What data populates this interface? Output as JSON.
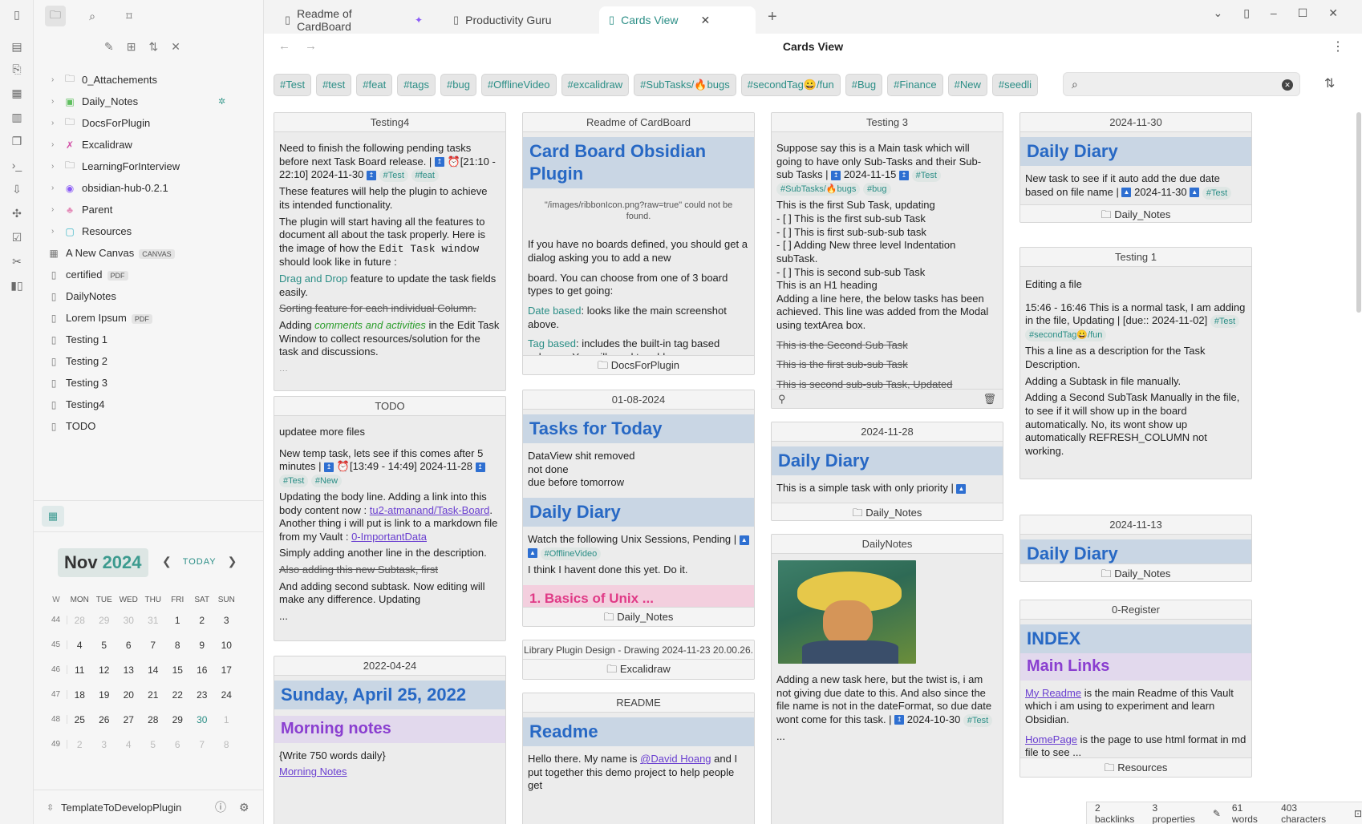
{
  "sidebar": {
    "tree": [
      {
        "type": "folder",
        "label": "0_Attachements",
        "icon": "folder-icon"
      },
      {
        "type": "folder",
        "label": "Daily_Notes",
        "icon": "calendar-folder-icon"
      },
      {
        "type": "folder",
        "label": "DocsForPlugin",
        "icon": "folder-icon"
      },
      {
        "type": "folder",
        "label": "Excalidraw",
        "icon": "excalidraw-icon"
      },
      {
        "type": "folder",
        "label": "LearningForInterview",
        "icon": "folder-icon"
      },
      {
        "type": "folder",
        "label": "obsidian-hub-0.2.1",
        "icon": "obsidian-hub-icon"
      },
      {
        "type": "folder",
        "label": "Parent",
        "icon": "tree-icon"
      },
      {
        "type": "folder",
        "label": "Resources",
        "icon": "resources-icon"
      }
    ],
    "files": [
      {
        "label": "A New Canvas",
        "badge": "CANVAS"
      },
      {
        "label": "certified",
        "badge": "PDF"
      },
      {
        "label": "DailyNotes",
        "badge": ""
      },
      {
        "label": "Lorem Ipsum",
        "badge": "PDF"
      },
      {
        "label": "Testing 1",
        "badge": ""
      },
      {
        "label": "Testing 2",
        "badge": ""
      },
      {
        "label": "Testing 3",
        "badge": ""
      },
      {
        "label": "Testing4",
        "badge": ""
      },
      {
        "label": "TODO",
        "badge": ""
      }
    ],
    "vault_name": "TemplateToDevelopPlugin"
  },
  "calendar": {
    "month": "Nov",
    "year": "2024",
    "today_label": "TODAY",
    "dow": [
      "W",
      "MON",
      "TUE",
      "WED",
      "THU",
      "FRI",
      "SAT",
      "SUN"
    ],
    "weeks": [
      {
        "wk": "44",
        "days": [
          "28",
          "29",
          "30",
          "31",
          "1",
          "2",
          "3"
        ]
      },
      {
        "wk": "45",
        "days": [
          "4",
          "5",
          "6",
          "7",
          "8",
          "9",
          "10"
        ]
      },
      {
        "wk": "46",
        "days": [
          "11",
          "12",
          "13",
          "14",
          "15",
          "16",
          "17"
        ]
      },
      {
        "wk": "47",
        "days": [
          "18",
          "19",
          "20",
          "21",
          "22",
          "23",
          "24"
        ]
      },
      {
        "wk": "48",
        "days": [
          "25",
          "26",
          "27",
          "28",
          "29",
          "30",
          "1"
        ]
      },
      {
        "wk": "49",
        "days": [
          "2",
          "3",
          "4",
          "5",
          "6",
          "7",
          "8"
        ]
      }
    ]
  },
  "tabs": [
    {
      "label": "Readme of CardBoard"
    },
    {
      "label": "Productivity Guru"
    },
    {
      "label": "Cards View"
    }
  ],
  "view_title": "Cards View",
  "tag_filters": [
    "#Test",
    "#test",
    "#feat",
    "#tags",
    "#bug",
    "#OfflineVideo",
    "#excalidraw",
    "#SubTasks/🔥bugs",
    "#secondTag😀/fun",
    "#Bug",
    "#Finance",
    "#New",
    "#seedli"
  ],
  "cards": {
    "testing4": {
      "title": "Testing4",
      "p1": "Need to finish the following pending tasks before next Task Board release. |",
      "p1b": "⏰[21:10 - 22:10]",
      "p1c": "2024-11-30",
      "tag1": "#Test",
      "tag2": "#feat",
      "p2": "These features will help the plugin to achieve its intended functionality.",
      "p3a": "The plugin will start having all the features to document all about the task properly. Here is the image of how the ",
      "p3code": "Edit Task window",
      "p3b": " should look like in future :",
      "p4link": "Drag and Drop",
      "p4": " feature to update the task fields easily.",
      "p5": "Sorting feature for each individual Column.",
      "p6a": "Adding ",
      "p6green": "comments and activities",
      "p6b": " in the Edit Task Window to collect resources/solution for the task and discussions.",
      "ellipsis": "..."
    },
    "todo": {
      "title": "TODO",
      "p1": "updatee more files",
      "p2": "New temp task, lets see if this comes after 5 minutes |",
      "p2b": "⏰[13:49 - 14:49]",
      "p2c": "2024-11-28",
      "tag1": "#Test",
      "tag2": "#New",
      "p3a": "Updating the body line. Adding a link into this body content now : ",
      "p3link": "tu2-atmanand/Task-Board",
      "p3b": ". Another thing i will put is link to a markdown file from my Vault : ",
      "p3link2": "0-ImportantData",
      "p4": "Simply adding another line in the description.",
      "p5": "Also adding this new Subtask, first",
      "p6": "And adding second subtask. Now editing will make any difference. Updating",
      "ellipsis": "..."
    },
    "sunday": {
      "title": "2022-04-24",
      "h1": "Sunday, April 25, 2022",
      "h2": "Morning notes",
      "p1": "{Write 750 words daily}",
      "p2": "Morning Notes"
    },
    "readme": {
      "title": "Readme of CardBoard",
      "h1": "Card Board Obsidian Plugin",
      "img": "\"/images/ribbonIcon.png?raw=true\" could not be found.",
      "p1": "If you have no boards defined, you should get a dialog asking you to add a new",
      "p2": "board.  You can choose from one of 3 board types to get going:",
      "p3link": "Date based",
      "p3": ": looks like the main screenshot above.",
      "p4link": "Tag based",
      "p4": ": includes the built-in tag based columns.  You will need to add",
      "ellipsis": "...",
      "footer": "DocsForPlugin"
    },
    "tasks_today": {
      "title": "01-08-2024",
      "h1": "Tasks for Today",
      "p1": "DataView shit removed",
      "p2": "not done",
      "p3": "due before tomorrow",
      "h1b": "Daily Diary",
      "p4": "Watch the following Unix Sessions, Pending |",
      "tag1": "#OfflineVideo",
      "p5": "I think I havent done this yet. Do it.",
      "h2": "1. Basics of Unix ...",
      "footer": "Daily_Notes"
    },
    "library": {
      "title": "Library Plugin Design - Drawing 2024-11-23 20.00.26.",
      "footer": "Excalidraw"
    },
    "readme2": {
      "title": "README",
      "h1": "Readme",
      "p1a": "Hello there. My name is ",
      "p1link": "@David Hoang",
      "p1b": " and I put together this demo project to help people get"
    },
    "testing3": {
      "title": "Testing 3",
      "p1": "Suppose say this is a Main task which will going to have only Sub-Tasks and their Sub-sub Tasks |",
      "p1c": "2024-11-15",
      "tag1": "#Test",
      "tag2": "#SubTasks/🔥bugs",
      "tag3": "#bug",
      "p2": "This is the first Sub Task, updating",
      "p3": "- [ ] This is the first sub-sub Task",
      "p4": "- [ ] This is first sub-sub-sub task",
      "p5": "- [ ] Adding New three level Indentation subTask.",
      "p6": "- [ ] This is second sub-sub Task",
      "p7": "This is an H1 heading",
      "p8": "Adding a line here, the below tasks has been achieved. This line was added from the Modal using textArea box.",
      "s1": "This is the Second Sub Task",
      "s2": "This is the first sub-sub Task",
      "s3": "This is second sub-sub Task, Updated",
      "ellipsis": "..."
    },
    "diary_1128": {
      "title": "2024-11-28",
      "h1": "Daily Diary",
      "p1": "This is a simple task with only priority |",
      "footer": "Daily_Notes"
    },
    "dailynotes": {
      "title": "DailyNotes",
      "p1": "Adding a new task here, but the twist is, i am not giving due date to this. And also since the file name is not in the dateFormat, so due date wont come for this task. |",
      "p1c": "2024-10-30",
      "tag1": "#Test",
      "ellipsis": "..."
    },
    "diary_1130": {
      "title": "2024-11-30",
      "h1": "Daily Diary",
      "p1": "New task to see if it auto add the due date based on file name |",
      "p1c": "2024-11-30",
      "tag1": "#Test",
      "footer": "Daily_Notes"
    },
    "testing1": {
      "title": "Testing 1",
      "p1": "Editing a file",
      "p2": "15:46 - 16:46 This is a normal task, I am adding in the file, Updating | [due:: 2024-11-02]",
      "tag1": "#Test",
      "tag2": "#secondTag😀/fun",
      "p3": "This a line as a description for the Task Description.",
      "p4": "Adding a Subtask in file manually.",
      "p5": "Adding a Second SubTask Manually in the file, to see if it will show up in the board automatically. No, its wont show up automatically REFRESH_COLUMN not working.",
      "ellipsis": "..."
    },
    "diary_1113": {
      "title": "2024-11-13",
      "h1": "Daily Diary",
      "footer": "Daily_Notes"
    },
    "register": {
      "title": "0-Register",
      "h1": "INDEX",
      "h2": "Main Links",
      "p1link": "My Readme",
      "p1": " is the main Readme of this Vault which i am using to experiment and learn Obsidian.",
      "p2link": "HomePage",
      "p2": " is the page to use html format in md file to see ...",
      "footer": "Resources"
    }
  },
  "status": {
    "backlinks": "2 backlinks",
    "properties": "3 properties",
    "words": "61 words",
    "chars": "403 characters"
  }
}
